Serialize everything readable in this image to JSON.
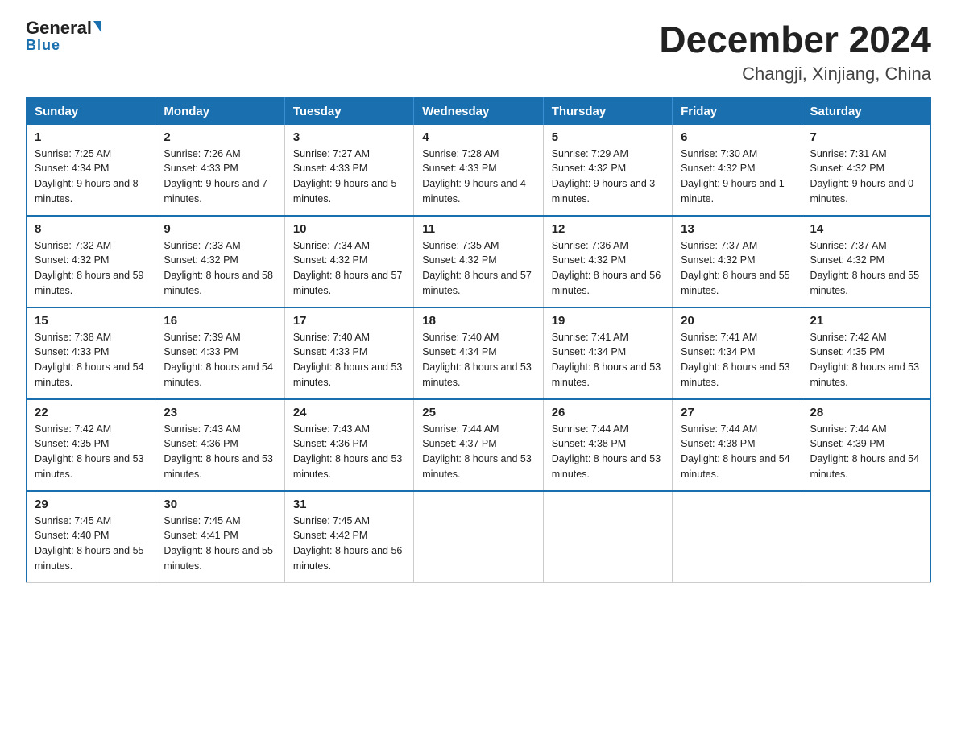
{
  "header": {
    "logo_general": "General",
    "logo_blue": "Blue",
    "title": "December 2024",
    "subtitle": "Changji, Xinjiang, China"
  },
  "columns": [
    "Sunday",
    "Monday",
    "Tuesday",
    "Wednesday",
    "Thursday",
    "Friday",
    "Saturday"
  ],
  "weeks": [
    [
      {
        "day": "1",
        "sunrise": "7:25 AM",
        "sunset": "4:34 PM",
        "daylight": "9 hours and 8 minutes."
      },
      {
        "day": "2",
        "sunrise": "7:26 AM",
        "sunset": "4:33 PM",
        "daylight": "9 hours and 7 minutes."
      },
      {
        "day": "3",
        "sunrise": "7:27 AM",
        "sunset": "4:33 PM",
        "daylight": "9 hours and 5 minutes."
      },
      {
        "day": "4",
        "sunrise": "7:28 AM",
        "sunset": "4:33 PM",
        "daylight": "9 hours and 4 minutes."
      },
      {
        "day": "5",
        "sunrise": "7:29 AM",
        "sunset": "4:32 PM",
        "daylight": "9 hours and 3 minutes."
      },
      {
        "day": "6",
        "sunrise": "7:30 AM",
        "sunset": "4:32 PM",
        "daylight": "9 hours and 1 minute."
      },
      {
        "day": "7",
        "sunrise": "7:31 AM",
        "sunset": "4:32 PM",
        "daylight": "9 hours and 0 minutes."
      }
    ],
    [
      {
        "day": "8",
        "sunrise": "7:32 AM",
        "sunset": "4:32 PM",
        "daylight": "8 hours and 59 minutes."
      },
      {
        "day": "9",
        "sunrise": "7:33 AM",
        "sunset": "4:32 PM",
        "daylight": "8 hours and 58 minutes."
      },
      {
        "day": "10",
        "sunrise": "7:34 AM",
        "sunset": "4:32 PM",
        "daylight": "8 hours and 57 minutes."
      },
      {
        "day": "11",
        "sunrise": "7:35 AM",
        "sunset": "4:32 PM",
        "daylight": "8 hours and 57 minutes."
      },
      {
        "day": "12",
        "sunrise": "7:36 AM",
        "sunset": "4:32 PM",
        "daylight": "8 hours and 56 minutes."
      },
      {
        "day": "13",
        "sunrise": "7:37 AM",
        "sunset": "4:32 PM",
        "daylight": "8 hours and 55 minutes."
      },
      {
        "day": "14",
        "sunrise": "7:37 AM",
        "sunset": "4:32 PM",
        "daylight": "8 hours and 55 minutes."
      }
    ],
    [
      {
        "day": "15",
        "sunrise": "7:38 AM",
        "sunset": "4:33 PM",
        "daylight": "8 hours and 54 minutes."
      },
      {
        "day": "16",
        "sunrise": "7:39 AM",
        "sunset": "4:33 PM",
        "daylight": "8 hours and 54 minutes."
      },
      {
        "day": "17",
        "sunrise": "7:40 AM",
        "sunset": "4:33 PM",
        "daylight": "8 hours and 53 minutes."
      },
      {
        "day": "18",
        "sunrise": "7:40 AM",
        "sunset": "4:34 PM",
        "daylight": "8 hours and 53 minutes."
      },
      {
        "day": "19",
        "sunrise": "7:41 AM",
        "sunset": "4:34 PM",
        "daylight": "8 hours and 53 minutes."
      },
      {
        "day": "20",
        "sunrise": "7:41 AM",
        "sunset": "4:34 PM",
        "daylight": "8 hours and 53 minutes."
      },
      {
        "day": "21",
        "sunrise": "7:42 AM",
        "sunset": "4:35 PM",
        "daylight": "8 hours and 53 minutes."
      }
    ],
    [
      {
        "day": "22",
        "sunrise": "7:42 AM",
        "sunset": "4:35 PM",
        "daylight": "8 hours and 53 minutes."
      },
      {
        "day": "23",
        "sunrise": "7:43 AM",
        "sunset": "4:36 PM",
        "daylight": "8 hours and 53 minutes."
      },
      {
        "day": "24",
        "sunrise": "7:43 AM",
        "sunset": "4:36 PM",
        "daylight": "8 hours and 53 minutes."
      },
      {
        "day": "25",
        "sunrise": "7:44 AM",
        "sunset": "4:37 PM",
        "daylight": "8 hours and 53 minutes."
      },
      {
        "day": "26",
        "sunrise": "7:44 AM",
        "sunset": "4:38 PM",
        "daylight": "8 hours and 53 minutes."
      },
      {
        "day": "27",
        "sunrise": "7:44 AM",
        "sunset": "4:38 PM",
        "daylight": "8 hours and 54 minutes."
      },
      {
        "day": "28",
        "sunrise": "7:44 AM",
        "sunset": "4:39 PM",
        "daylight": "8 hours and 54 minutes."
      }
    ],
    [
      {
        "day": "29",
        "sunrise": "7:45 AM",
        "sunset": "4:40 PM",
        "daylight": "8 hours and 55 minutes."
      },
      {
        "day": "30",
        "sunrise": "7:45 AM",
        "sunset": "4:41 PM",
        "daylight": "8 hours and 55 minutes."
      },
      {
        "day": "31",
        "sunrise": "7:45 AM",
        "sunset": "4:42 PM",
        "daylight": "8 hours and 56 minutes."
      },
      null,
      null,
      null,
      null
    ]
  ]
}
